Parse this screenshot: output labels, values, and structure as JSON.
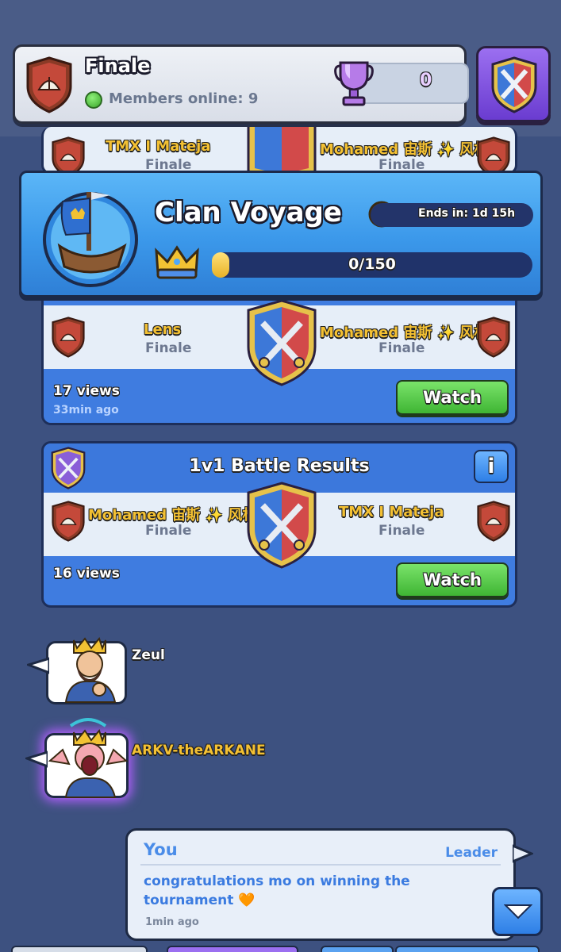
{
  "header": {
    "clan_name": "Finale",
    "members_online": "Members online: 9",
    "trophies": "0"
  },
  "cards": [
    {
      "left_player": "TMX I Mateja",
      "left_clan": "Finale",
      "right_player": "Mohamed 宙斯 ✨ 风林",
      "right_clan": "Finale"
    },
    {
      "left_player": "Lens",
      "left_clan": "Finale",
      "right_player": "Mohamed 宙斯 ✨ 风林",
      "right_clan": "Finale",
      "views": "17 views",
      "time": "33min ago",
      "watch_label": "Watch"
    },
    {
      "title": "1v1 Battle Results",
      "info_label": "i",
      "left_player": "Mohamed 宙斯 ✨ 风林",
      "left_clan": "Finale",
      "right_player": "TMX I Mateja",
      "right_clan": "Finale",
      "views": "16 views",
      "watch_label": "Watch"
    }
  ],
  "voyage": {
    "title": "Clan Voyage",
    "ends_in": "Ends in: 1d 15h",
    "progress_text": "0/150",
    "progress_fraction": 0
  },
  "chat": {
    "users": [
      {
        "name": "Zeul"
      },
      {
        "name": "ARKV-theARKANE"
      }
    ],
    "message": {
      "author": "You",
      "role": "Leader",
      "text": "congratulations mo on winning the tournament 🧡",
      "time": "1min ago"
    }
  },
  "colors": {
    "background": "#3d5180",
    "card_blue": "#3f7ce0",
    "watch_green": "#4fc23f",
    "gold_name": "#f4c133",
    "voyage_blue": "#4aa8f2"
  }
}
